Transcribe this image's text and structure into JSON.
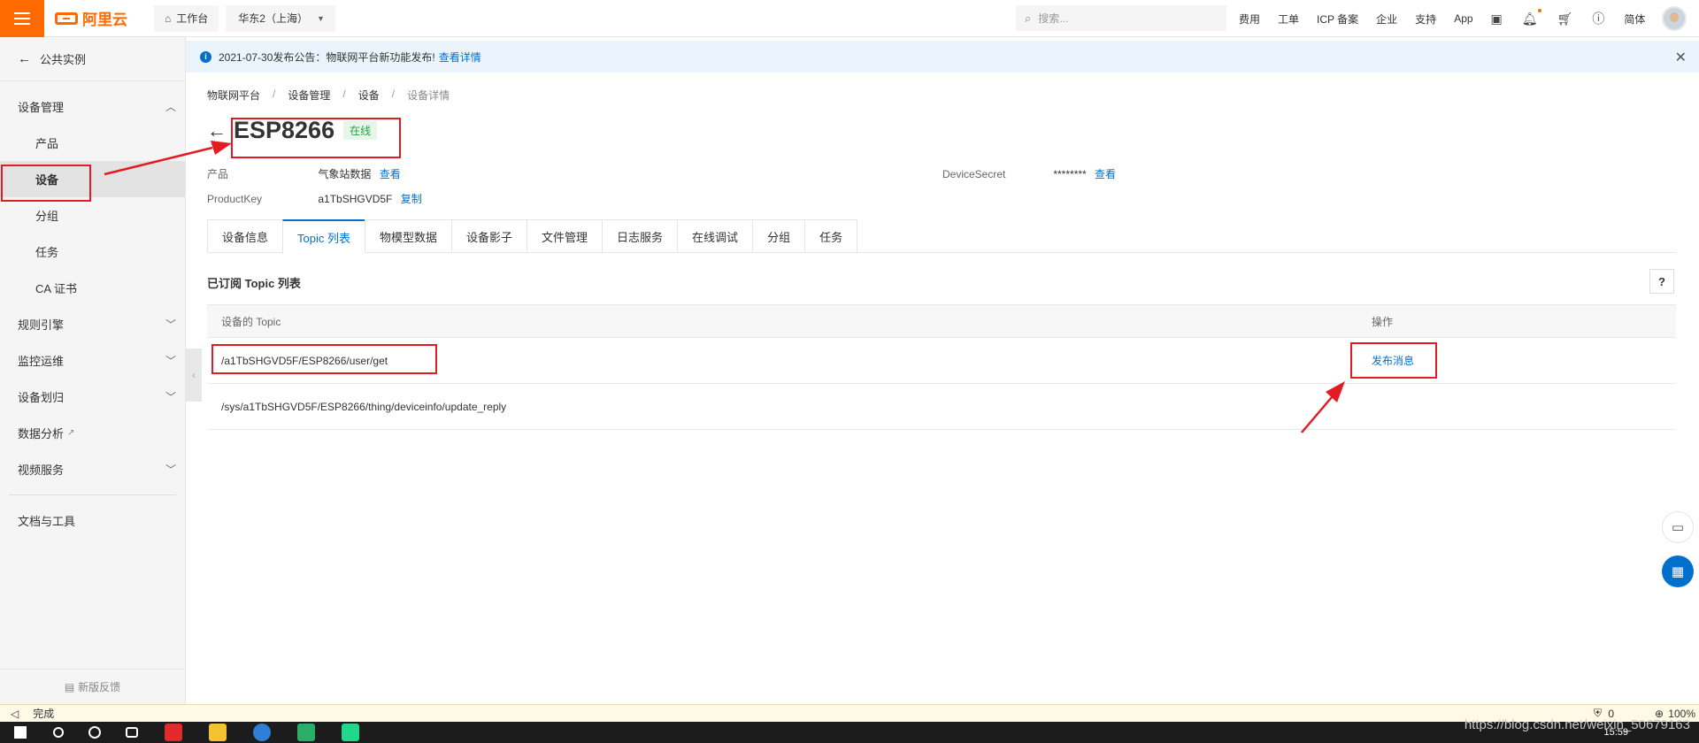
{
  "topbar": {
    "brand": "阿里云",
    "workbench": "工作台",
    "region": "华东2（上海）",
    "search_placeholder": "搜索...",
    "nav": [
      "费用",
      "工单",
      "ICP 备案",
      "企业",
      "支持",
      "App"
    ],
    "lang": "简体"
  },
  "sidebar": {
    "back_label": "公共实例",
    "group_device": "设备管理",
    "items": [
      "产品",
      "设备",
      "分组",
      "任务",
      "CA 证书"
    ],
    "groups": [
      "规则引擎",
      "监控运维",
      "设备划归",
      "数据分析",
      "视频服务"
    ],
    "docs": "文档与工具",
    "feedback": "新版反馈"
  },
  "notice": {
    "text": "2021-07-30发布公告：物联网平台新功能发布!",
    "link": "查看详情"
  },
  "breadcrumb": [
    "物联网平台",
    "设备管理",
    "设备",
    "设备详情"
  ],
  "device": {
    "name": "ESP8266",
    "status": "在线",
    "product_label": "产品",
    "product_value": "气象站数据",
    "product_link": "查看",
    "productkey_label": "ProductKey",
    "productkey_value": "a1TbSHGVD5F",
    "productkey_link": "复制",
    "secret_label": "DeviceSecret",
    "secret_value": "********",
    "secret_link": "查看"
  },
  "tabs": [
    "设备信息",
    "Topic 列表",
    "物模型数据",
    "设备影子",
    "文件管理",
    "日志服务",
    "在线调试",
    "分组",
    "任务"
  ],
  "section_title": "已订阅 Topic 列表",
  "help": "?",
  "table": {
    "col_topic": "设备的 Topic",
    "col_action": "操作",
    "rows": [
      {
        "topic": "/a1TbSHGVD5F/ESP8266/user/get",
        "action": "发布消息"
      },
      {
        "topic": "/sys/a1TbSHGVD5F/ESP8266/thing/deviceinfo/update_reply",
        "action": ""
      }
    ]
  },
  "statusbar": {
    "text": "完成",
    "badge": "0",
    "zoom": "100%"
  },
  "taskbar": {
    "time": "15:59"
  },
  "watermark": "https://blog.csdn.net/weixin_50679163",
  "colors": {
    "accent": "#ff6a00",
    "link": "#0070cc",
    "annotation": "#e31b23",
    "online": "#2a9d40"
  }
}
